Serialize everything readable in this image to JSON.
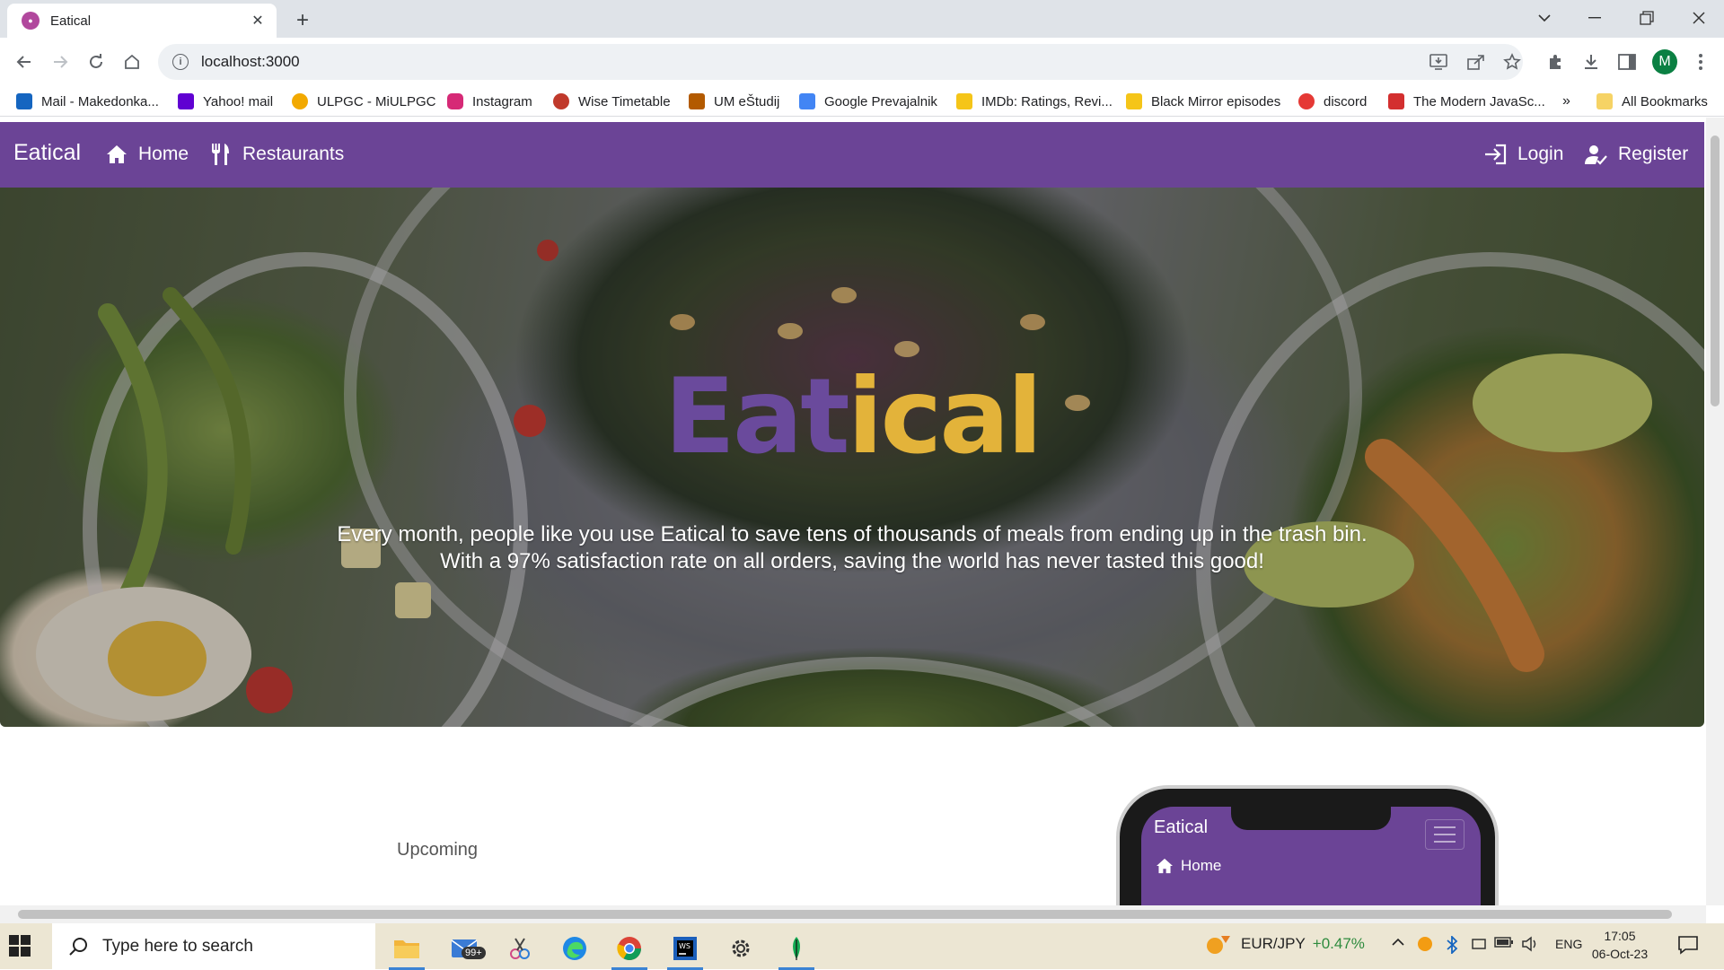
{
  "browser": {
    "tab_title": "Eatical",
    "tab_favicon": "eatical-favicon",
    "url": "localhost:3000",
    "profile_initial": "M",
    "bookmarks": [
      {
        "label": "Mail - Makedonka...",
        "color": "#1565c0"
      },
      {
        "label": "Yahoo! mail",
        "color": "#6001d2"
      },
      {
        "label": "ULPGC - MiULPGC",
        "color": "#f2a900"
      },
      {
        "label": "Instagram",
        "color": "#d62976"
      },
      {
        "label": "Wise Timetable",
        "color": "#c0392b"
      },
      {
        "label": "UM eŠtudij",
        "color": "#b35a00"
      },
      {
        "label": "Google Prevajalnik",
        "color": "#4285f4"
      },
      {
        "label": "IMDb: Ratings, Revi...",
        "color": "#f5c518"
      },
      {
        "label": "Black Mirror episodes",
        "color": "#f5c518"
      },
      {
        "label": "discord",
        "color": "#e53935"
      },
      {
        "label": "The Modern JavaSc...",
        "color": "#d32f2f"
      }
    ],
    "bookmarks_overflow": "»",
    "all_bookmarks_label": "All Bookmarks"
  },
  "site": {
    "brand": "Eatical",
    "nav": {
      "home": "Home",
      "restaurants": "Restaurants",
      "login": "Login",
      "register": "Register"
    },
    "hero": {
      "title_part1": "Eat",
      "title_part2": "ical",
      "line1": "Every month, people like you use Eatical to save tens of thousands of meals from ending up in the trash bin.",
      "line2": "With a 97% satisfaction rate on all orders, saving the world has never tasted this good!"
    },
    "upcoming_label": "Upcoming",
    "phone": {
      "brand": "Eatical",
      "home": "Home"
    },
    "colors": {
      "primary": "#6b4496",
      "accent": "#e3b33a"
    }
  },
  "taskbar": {
    "search_placeholder": "Type here to search",
    "mail_badge": "99+",
    "ticker_label": "EUR/JPY",
    "ticker_change": "+0.47%",
    "language": "ENG",
    "time": "17:05",
    "date": "06-Oct-23"
  }
}
